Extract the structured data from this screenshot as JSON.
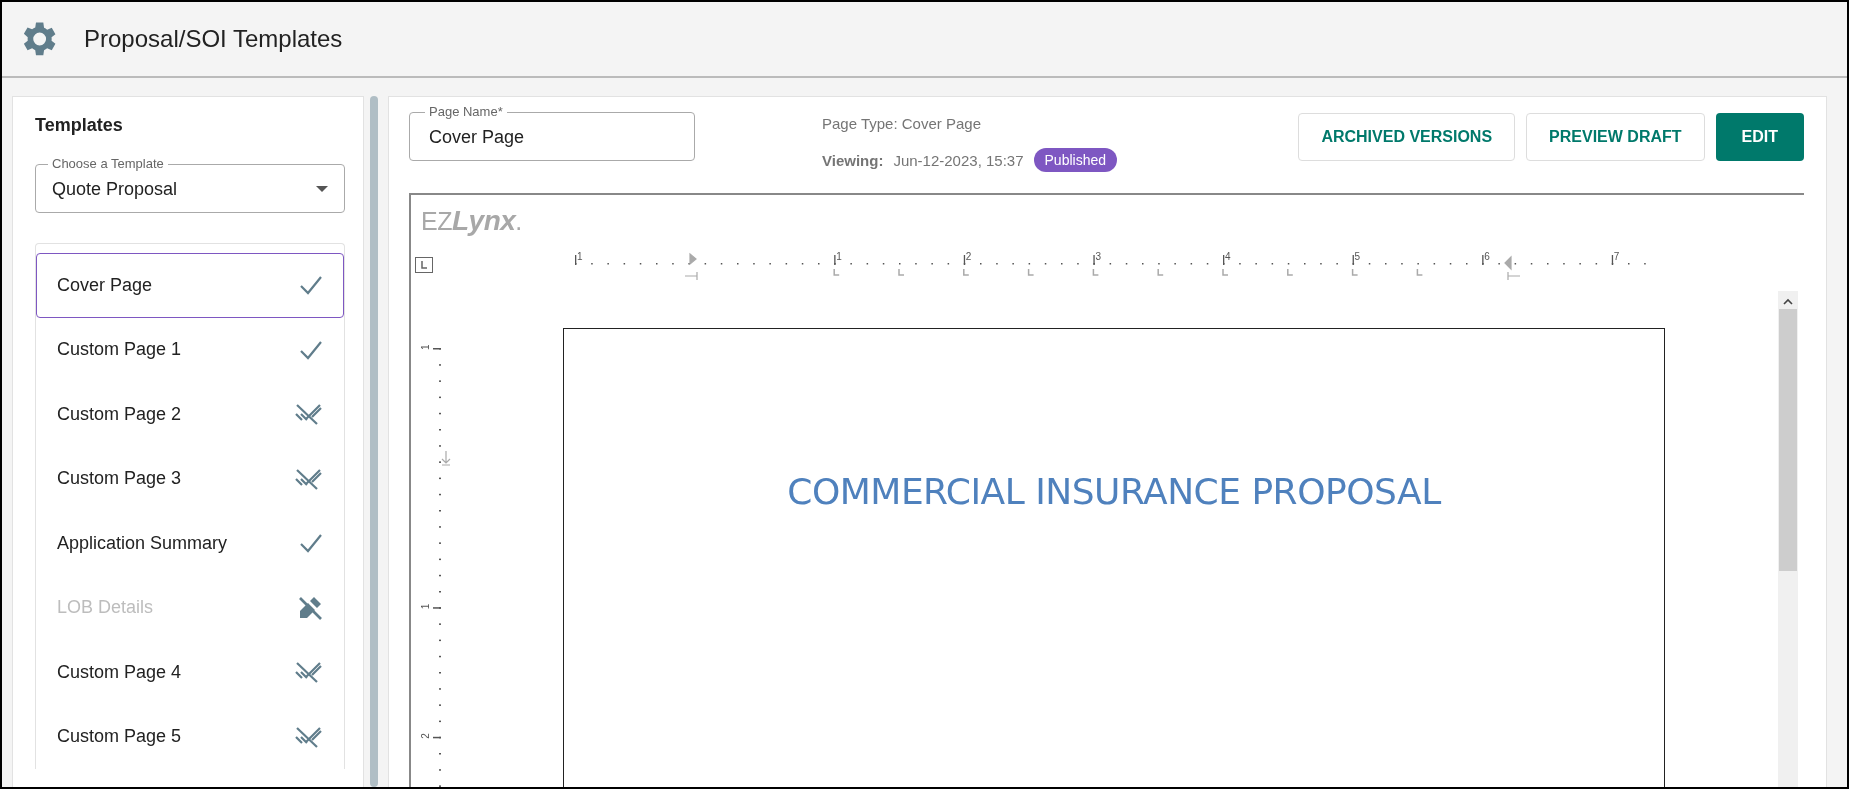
{
  "header": {
    "title": "Proposal/SOI Templates"
  },
  "sidebar": {
    "heading": "Templates",
    "template_select": {
      "label": "Choose a Template",
      "value": "Quote Proposal"
    },
    "pages": [
      {
        "label": "Cover Page",
        "kind": "published",
        "selected": true,
        "disabled": false
      },
      {
        "label": "Custom Page 1",
        "kind": "published",
        "selected": false,
        "disabled": false
      },
      {
        "label": "Custom Page 2",
        "kind": "unpublished",
        "selected": false,
        "disabled": false
      },
      {
        "label": "Custom Page 3",
        "kind": "unpublished",
        "selected": false,
        "disabled": false
      },
      {
        "label": "Application Summary",
        "kind": "published",
        "selected": false,
        "disabled": false
      },
      {
        "label": "LOB Details",
        "kind": "locked",
        "selected": false,
        "disabled": true
      },
      {
        "label": "Custom Page 4",
        "kind": "unpublished",
        "selected": false,
        "disabled": false
      },
      {
        "label": "Custom Page 5",
        "kind": "unpublished",
        "selected": false,
        "disabled": false
      }
    ]
  },
  "main": {
    "page_name": {
      "label": "Page Name*",
      "value": "Cover Page"
    },
    "page_type": "Page Type: Cover Page",
    "viewing_label": "Viewing:",
    "viewing_date": "Jun-12-2023, 15:37",
    "status_badge": "Published",
    "buttons": [
      {
        "label": "ARCHIVED VERSIONS",
        "kind": "outlined"
      },
      {
        "label": "PREVIEW DRAFT",
        "kind": "outlined"
      },
      {
        "label": "EDIT",
        "kind": "filled"
      }
    ],
    "editor": {
      "logo": "EZ**Lynx**.",
      "ruler_numbers": [
        "1",
        "1",
        "2",
        "3",
        "4",
        "5",
        "6",
        "7"
      ],
      "vertical_ruler_numbers": [
        "1",
        "1",
        "2"
      ],
      "document_title": "COMMERCIAL INSURANCE PROPOSAL"
    }
  }
}
